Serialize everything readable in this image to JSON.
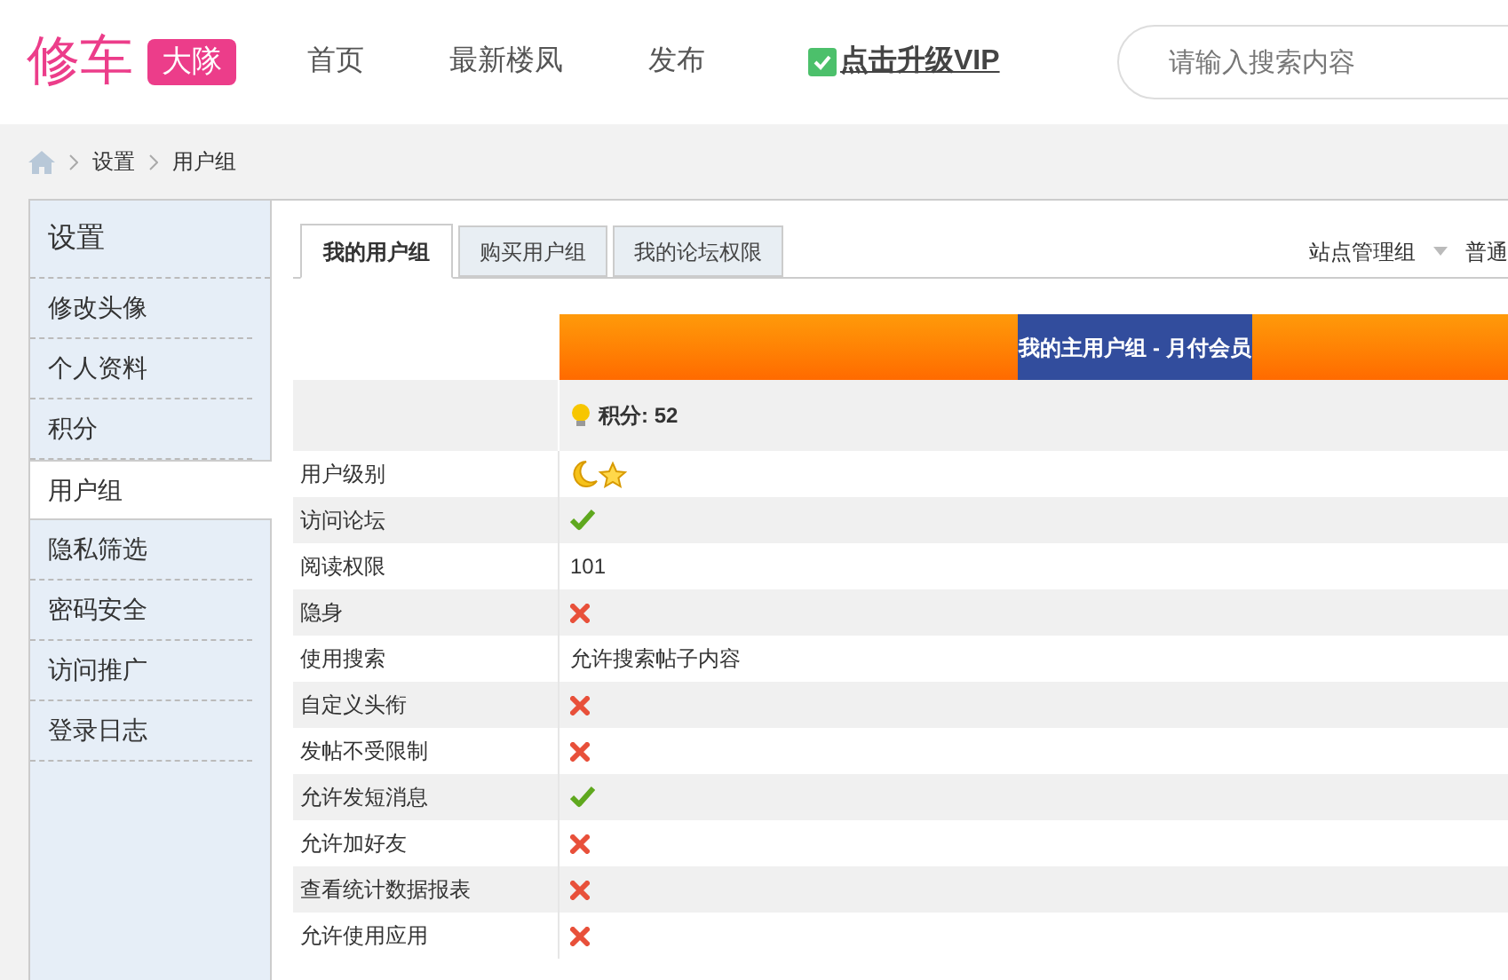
{
  "logo": {
    "text": "修车",
    "badge": "大隊"
  },
  "nav": [
    {
      "label": "首页",
      "kind": "plain"
    },
    {
      "label": "最新楼凤",
      "kind": "plain"
    },
    {
      "label": "发布",
      "kind": "plain"
    },
    {
      "label": "点击升级VIP",
      "kind": "vip"
    }
  ],
  "search": {
    "placeholder": "请输入搜索内容"
  },
  "breadcrumb": [
    "设置",
    "用户组"
  ],
  "sidebar": {
    "title": "设置",
    "items": [
      {
        "label": "修改头像",
        "selected": false
      },
      {
        "label": "个人资料",
        "selected": false
      },
      {
        "label": "积分",
        "selected": false
      },
      {
        "label": "用户组",
        "selected": true
      },
      {
        "label": "隐私筛选",
        "selected": false
      },
      {
        "label": "密码安全",
        "selected": false
      },
      {
        "label": "访问推广",
        "selected": false
      },
      {
        "label": "登录日志",
        "selected": false
      }
    ]
  },
  "tabs": [
    {
      "label": "我的用户组",
      "selected": true
    },
    {
      "label": "购买用户组",
      "selected": false
    },
    {
      "label": "我的论坛权限",
      "selected": false
    }
  ],
  "group_switch": {
    "current": "站点管理组",
    "next": "普通"
  },
  "group_header": "我的主用户组 - 月付会员",
  "points": "积分: 52",
  "rows": [
    {
      "label": "用户级别",
      "kind": "level"
    },
    {
      "label": "访问论坛",
      "kind": "flag",
      "allowed": true
    },
    {
      "label": "阅读权限",
      "kind": "text",
      "value": "101"
    },
    {
      "label": "隐身",
      "kind": "flag",
      "allowed": false
    },
    {
      "label": "使用搜索",
      "kind": "text",
      "value": "允许搜索帖子内容"
    },
    {
      "label": "自定义头衔",
      "kind": "flag",
      "allowed": false
    },
    {
      "label": "发帖不受限制",
      "kind": "flag",
      "allowed": false
    },
    {
      "label": "允许发短消息",
      "kind": "flag",
      "allowed": true
    },
    {
      "label": "允许加好友",
      "kind": "flag",
      "allowed": false
    },
    {
      "label": "查看统计数据报表",
      "kind": "flag",
      "allowed": false
    },
    {
      "label": "允许使用应用",
      "kind": "flag",
      "allowed": false
    }
  ]
}
